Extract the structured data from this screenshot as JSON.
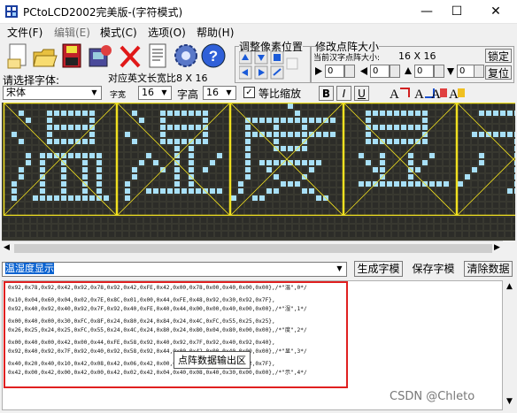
{
  "window": {
    "title": "PCtoLCD2002完美版-(字符模式)"
  },
  "window_controls": {
    "minimize": "—",
    "maximize": "☐",
    "close": "✕"
  },
  "menu": [
    "文件(F)",
    "编辑(E)",
    "模式(C)",
    "选项(O)",
    "帮助(H)"
  ],
  "toolbar": {
    "icons": [
      "new-icon",
      "open-icon",
      "save-icon",
      "image-save-icon",
      "delete-icon",
      "document-icon",
      "gear-icon",
      "help-icon"
    ],
    "pixel_adjust_label": "调整像素位置",
    "dot_size_label": "修改点阵大小",
    "dot_size_sub_label": "当前汉字点阵大小:",
    "dot_size_value": "16 X 16",
    "lock_button": "锁定",
    "reset_button": "复位",
    "spin_values": [
      "0",
      "0",
      "0",
      "0"
    ]
  },
  "font_row": {
    "select_font_label": "请选择字体:",
    "font_value": "宋体",
    "en_width_label": "对应英文长宽比8 X 16",
    "width_label": "字宽",
    "width_value": "16",
    "height_label": "字高",
    "height_value": "16",
    "scale_checkbox_label": "等比缩放",
    "bold_button": "B",
    "italic_button": "I",
    "underline_button": "U"
  },
  "input_row": {
    "text_value": "温湿度显示",
    "generate_button": "生成字模",
    "save_button": "保存字模",
    "clear_button": "清除数据"
  },
  "output": {
    "lines": [
      "0x92,0x78,0x92,0x42,0x92,0x78,0x92,0x42,0xFE,0x42,0x00,0x78,0x00,0x40,0x00,0x00},/*\"温\",0*/",
      "",
      "0x10,0x04,0x60,0x04,0x02,0x7E,0x8C,0x01,0x00,0x44,0xFE,0x48,0x92,0x30,0x92,0x7F},",
      "0x92,0x40,0x92,0x40,0x92,0x7F,0x92,0x40,0xFE,0x40,0x44,0x00,0x00,0x40,0x00,0x00},/*\"湿\",1*/",
      "",
      "0x00,0x40,0x00,0x30,0xFC,0x8F,0x24,0x80,0x24,0x84,0x24,0x4C,0xFC,0x55,0x25,0x25},",
      "0x26,0x25,0x24,0x25,0xFC,0x55,0x24,0x4C,0x24,0x80,0x24,0x80,0x04,0x80,0x00,0x00},/*\"度\",2*/",
      "",
      "0x00,0x40,0x00,0x42,0x00,0x44,0xFE,0x58,0x92,0x40,0x92,0x7F,0x92,0x40,0x92,0x40},",
      "0x92,0x40,0x92,0x7F,0x92,0x40,0x92,0x58,0x92,0x44,0x00,0x42,0x00,0x40,0x00,0x00},/*\"显\",3*/",
      "",
      "0x40,0x20,0x40,0x10,0x42,0x08,0x42,0x06,0x42,0x00,0x42,0x40,0x42,0x80,0xC2,0x7F},",
      "0x42,0x00,0x42,0x00,0x42,0x00,0x42,0x02,0x42,0x04,0x40,0x08,0x40,0x30,0x00,0x00},/*\"示\",4*/"
    ],
    "tooltip": "点阵数据输出区"
  },
  "watermark": "CSDN @Chleto",
  "colors": {
    "matrix_bg": "#383830",
    "dot_off": "#2c2c28",
    "dot_on": "#a8e0f8",
    "grid_line": "#f0e020",
    "highlight": "#e02020"
  },
  "glyph_chars": [
    "温",
    "湿",
    "度",
    "显",
    "示"
  ]
}
